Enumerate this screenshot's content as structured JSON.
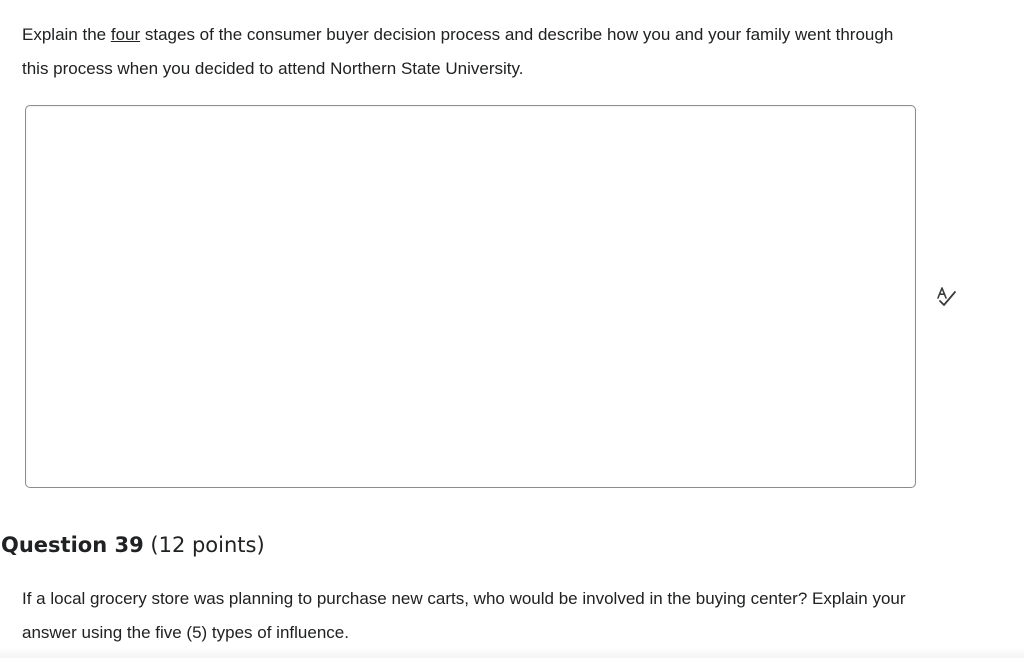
{
  "question38": {
    "prompt_before": "Explain the ",
    "prompt_underlined": "four",
    "prompt_after": " stages of the consumer buyer decision process and describe how you and your family went through this process when you decided to attend Northern State University.",
    "answer_value": ""
  },
  "spell_check": {
    "icon": "spell-check-icon"
  },
  "question39": {
    "title": "Question 39",
    "points": "(12 points)",
    "prompt": "If a local grocery store was planning to purchase new carts, who would be involved in the buying center? Explain your answer using the five (5) types of influence."
  }
}
